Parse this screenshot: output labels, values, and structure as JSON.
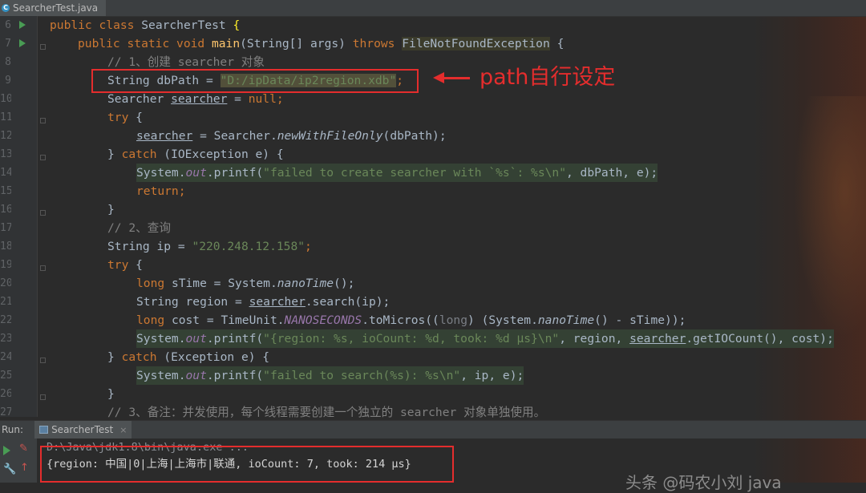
{
  "editor": {
    "tab_label": "SearcherTest.java",
    "line_numbers": [
      "6",
      "7",
      "8",
      "9",
      "10",
      "11",
      "12",
      "13",
      "14",
      "15",
      "16",
      "17",
      "18",
      "19",
      "20",
      "21",
      "22",
      "23",
      "24",
      "25",
      "26",
      "27"
    ]
  },
  "code": {
    "l6": {
      "kw1": "public",
      "kw2": "class",
      "name": "SearcherTest",
      "brace": "{"
    },
    "l7": {
      "kw1": "public",
      "kw2": "static",
      "kw3": "void",
      "fn": "main",
      "args": "(String[] args) ",
      "kw4": "throws",
      "exc": "FileNotFoundException",
      "brace": "{"
    },
    "l8": {
      "comment": "// 1、创建 searcher 对象"
    },
    "l9": {
      "type": "String dbPath = ",
      "str": "\"D:/ipData/ip2region.xdb\"",
      "semi": ";"
    },
    "l10": {
      "a": "Searcher ",
      "var": "searcher",
      "b": " = ",
      "kw": "null",
      "c": ";"
    },
    "l11": {
      "kw": "try",
      "b": " {"
    },
    "l12": {
      "var": "searcher",
      "b": " = Searcher.",
      "m": "newWithFileOnly",
      "c": "(dbPath);"
    },
    "l13": {
      "a": "} ",
      "kw": "catch",
      "b": " (IOException e) {"
    },
    "l14": {
      "a": "System.",
      "f": "out",
      "b": ".printf(",
      "str": "\"failed to create searcher with `%s`: %s\\n\"",
      "c": ", dbPath, e);"
    },
    "l15": {
      "kw": "return",
      "c": ";"
    },
    "l16": {
      "a": "}"
    },
    "l17": {
      "comment": "// 2、查询"
    },
    "l18": {
      "a": "String ip = ",
      "str": "\"220.248.12.158\"",
      "c": ";"
    },
    "l19": {
      "kw": "try",
      "b": " {"
    },
    "l20": {
      "kw": "long",
      "a": " sTime = System.",
      "m": "nanoTime",
      "c": "();"
    },
    "l21": {
      "a": "String region = ",
      "var": "searcher",
      "b": ".search(ip);"
    },
    "l22": {
      "kw": "long",
      "a": " cost = TimeUnit.",
      "f": "NANOSECONDS",
      "b": ".toMicros((",
      "kw2": "long",
      "c": ") (System.",
      "m": "nanoTime",
      "d": "() - sTime));"
    },
    "l23": {
      "a": "System.",
      "f": "out",
      "b": ".printf(",
      "str": "\"{region: %s, ioCount: %d, took: %d μs}\\n\"",
      "c": ", region, ",
      "var": "searcher",
      "d": ".getIOCount(), cost);"
    },
    "l24": {
      "a": "} ",
      "kw": "catch",
      "b": " (Exception e) {"
    },
    "l25": {
      "a": "System.",
      "f": "out",
      "b": ".printf(",
      "str": "\"failed to search(%s): %s\\n\"",
      "c": ", ip, e);"
    },
    "l26": {
      "a": "}"
    },
    "l27": {
      "comment": "// 3、备注：并发使用，每个线程需要创建一个独立的 searcher 对象单独使用。"
    }
  },
  "annotation": {
    "text": "path自行设定"
  },
  "run": {
    "label": "Run:",
    "tab_label": "SearcherTest",
    "close": "×",
    "cmd": "D:\\Java\\jdk1.8\\bin\\java.exe ...",
    "output": "{region: 中国|0|上海|上海市|联通, ioCount: 7, took: 214 μs}"
  },
  "watermark": {
    "text": "头条 @码农小刘 java"
  },
  "colors": {
    "annotation_red": "#e42d2d",
    "keyword": "#cc7832",
    "string": "#6a8759",
    "comment": "#808080",
    "field": "#9876aa",
    "method": "#ffc66d"
  }
}
